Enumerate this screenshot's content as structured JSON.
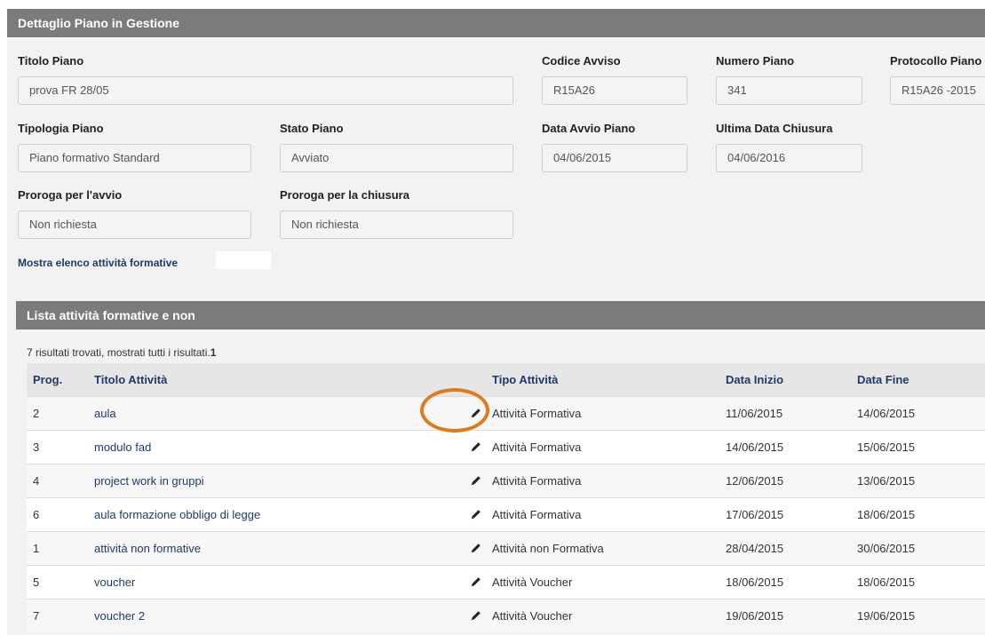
{
  "panel": {
    "title": "Dettaglio Piano in Gestione"
  },
  "fields": {
    "titolo_piano": {
      "label": "Titolo Piano",
      "value": "prova FR 28/05"
    },
    "codice_avviso": {
      "label": "Codice Avviso",
      "value": "R15A26"
    },
    "numero_piano": {
      "label": "Numero Piano",
      "value": "341"
    },
    "protocollo_piano": {
      "label": "Protocollo Piano",
      "value": "R15A26 -2015"
    },
    "tipologia_piano": {
      "label": "Tipologia Piano",
      "value": "Piano formativo Standard"
    },
    "stato_piano": {
      "label": "Stato Piano",
      "value": "Avviato"
    },
    "data_avvio_piano": {
      "label": "Data Avvio Piano",
      "value": "04/06/2015"
    },
    "ultima_data_chiusura": {
      "label": "Ultima Data Chiusura",
      "value": "04/06/2016"
    },
    "proroga_avvio": {
      "label": "Proroga per l'avvio",
      "value": "Non richiesta"
    },
    "proroga_chiusura": {
      "label": "Proroga per la chiusura",
      "value": "Non richiesta"
    }
  },
  "show_list_link": "Mostra elenco attività formative",
  "list": {
    "title": "Lista attività formative e non",
    "results_text": "7 risultati trovati, mostrati tutti i risultati.",
    "results_page": "1",
    "columns": [
      "Prog.",
      "Titolo Attività",
      "Tipo Attività",
      "Data Inizio",
      "Data Fine"
    ],
    "rows": [
      {
        "prog": "2",
        "titolo": "aula",
        "tipo": "Attività Formativa",
        "inizio": "11/06/2015",
        "fine": "14/06/2015"
      },
      {
        "prog": "3",
        "titolo": "modulo fad",
        "tipo": "Attività Formativa",
        "inizio": "14/06/2015",
        "fine": "15/06/2015"
      },
      {
        "prog": "4",
        "titolo": "project work in gruppi",
        "tipo": "Attività Formativa",
        "inizio": "12/06/2015",
        "fine": "13/06/2015"
      },
      {
        "prog": "6",
        "titolo": "aula formazione obbligo di legge",
        "tipo": "Attività Formativa",
        "inizio": "17/06/2015",
        "fine": "18/06/2015"
      },
      {
        "prog": "1",
        "titolo": "attività non formative",
        "tipo": "Attività non Formativa",
        "inizio": "28/04/2015",
        "fine": "30/06/2015"
      },
      {
        "prog": "5",
        "titolo": "voucher",
        "tipo": "Attività Voucher",
        "inizio": "18/06/2015",
        "fine": "18/06/2015"
      },
      {
        "prog": "7",
        "titolo": "voucher 2",
        "tipo": "Attività Voucher",
        "inizio": "19/06/2015",
        "fine": "19/06/2015"
      }
    ]
  },
  "colors": {
    "header_bg": "#7b7b7b",
    "highlight": "#e07a1f",
    "link": "#1f3a66"
  },
  "icons": {
    "edit": "pencil-icon"
  }
}
